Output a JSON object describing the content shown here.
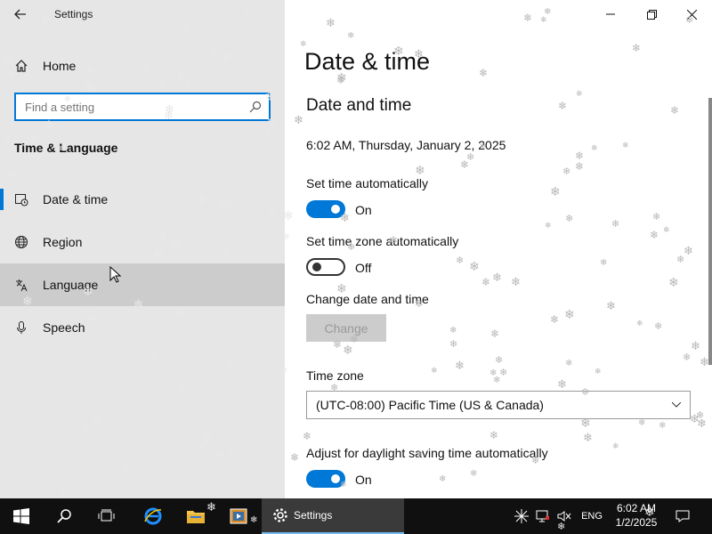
{
  "window": {
    "title": "Settings"
  },
  "sidebar": {
    "home_label": "Home",
    "search_placeholder": "Find a setting",
    "section_title": "Time & Language",
    "items": [
      {
        "label": "Date & time",
        "icon": "calendar-clock-icon",
        "selected": true
      },
      {
        "label": "Region",
        "icon": "globe-icon"
      },
      {
        "label": "Language",
        "icon": "language-icon",
        "hovered": true
      },
      {
        "label": "Speech",
        "icon": "microphone-icon"
      }
    ]
  },
  "main": {
    "page_title": "Date & time",
    "section_title": "Date and time",
    "current_datetime": "6:02 AM, Thursday, January 2, 2025",
    "set_time_auto": {
      "label": "Set time automatically",
      "state": "On"
    },
    "set_timezone_auto": {
      "label": "Set time zone automatically",
      "state": "Off"
    },
    "change_date_time": {
      "label": "Change date and time",
      "button": "Change"
    },
    "time_zone": {
      "label": "Time zone",
      "value": "(UTC-08:00) Pacific Time (US & Canada)"
    },
    "daylight_saving": {
      "label": "Adjust for daylight saving time automatically",
      "state": "On"
    }
  },
  "taskbar": {
    "active_app": "Settings",
    "language": "ENG",
    "clock_time": "6:02 AM",
    "clock_date": "1/2/2025"
  },
  "colors": {
    "accent": "#0078d7",
    "sidebar_bg": "#e6e6e6",
    "taskbar_bg": "#101010"
  }
}
